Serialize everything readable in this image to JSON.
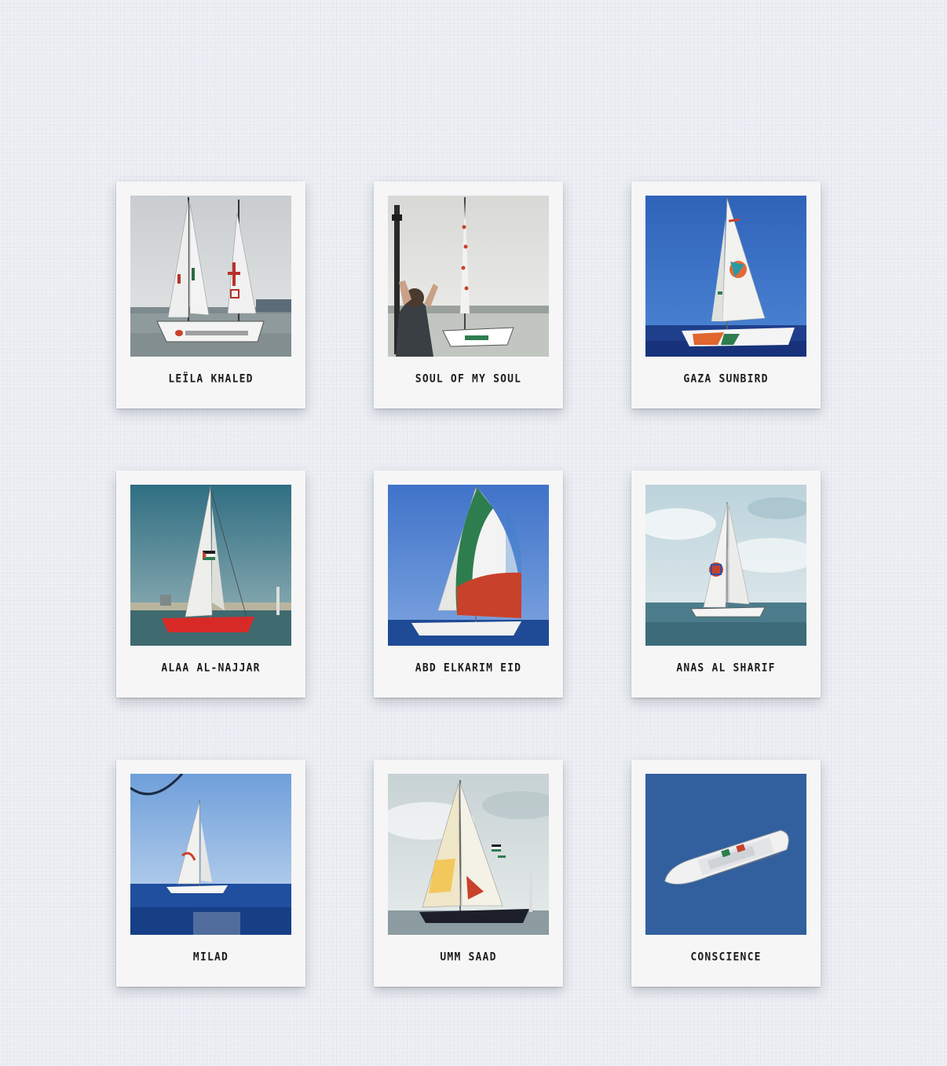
{
  "gallery": {
    "boats": [
      {
        "name": "LEÏLA KHALED",
        "photo_icon": "sailboat-harbor-icon"
      },
      {
        "name": "SOUL OF MY SOUL",
        "photo_icon": "sailboat-crowd-icon"
      },
      {
        "name": "GAZA SUNBIRD",
        "photo_icon": "sailboat-open-sea-icon"
      },
      {
        "name": "ALAA AL-NAJJAR",
        "photo_icon": "sailboat-red-hull-icon"
      },
      {
        "name": "ABD ELKARIM EID",
        "photo_icon": "sailboat-spinnaker-icon"
      },
      {
        "name": "ANAS AL SHARIF",
        "photo_icon": "sailboat-cloudy-icon"
      },
      {
        "name": "MILAD",
        "photo_icon": "sailboat-distant-icon"
      },
      {
        "name": "UMM SAAD",
        "photo_icon": "sailboat-painted-sail-icon"
      },
      {
        "name": "CONSCIENCE",
        "photo_icon": "ship-aerial-icon"
      }
    ]
  },
  "colors": {
    "background": "#e9ecf2",
    "card": "#f6f6f6",
    "caption_text": "#1b1b1b",
    "palestine_red": "#c8412b",
    "palestine_green": "#2e7d4f"
  }
}
